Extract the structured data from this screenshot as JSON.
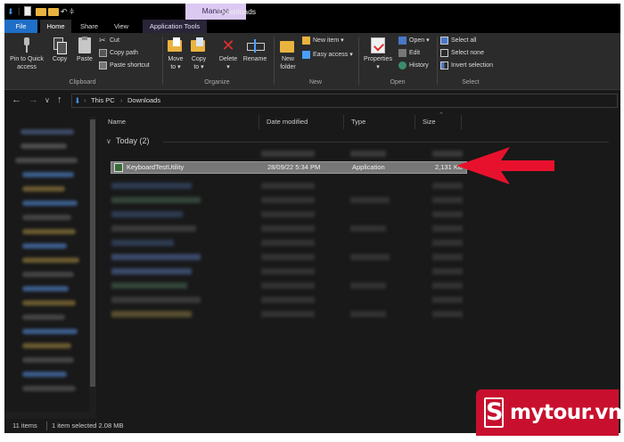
{
  "titlebar": {
    "context_tab": "Manage",
    "window_title": "Downloads"
  },
  "tabs": {
    "file": "File",
    "home": "Home",
    "share": "Share",
    "view": "View",
    "app_tools": "Application Tools"
  },
  "ribbon": {
    "clipboard": {
      "pin_line1": "Pin to Quick",
      "pin_line2": "access",
      "copy": "Copy",
      "paste": "Paste",
      "cut": "Cut",
      "copy_path": "Copy path",
      "paste_shortcut": "Paste shortcut",
      "label": "Clipboard"
    },
    "organize": {
      "move_line1": "Move",
      "move_line2": "to",
      "copy_line1": "Copy",
      "copy_line2": "to",
      "delete": "Delete",
      "rename": "Rename",
      "label": "Organize"
    },
    "new": {
      "new_folder_line1": "New",
      "new_folder_line2": "folder",
      "new_item": "New item",
      "easy_access": "Easy access",
      "label": "New"
    },
    "open": {
      "properties": "Properties",
      "open": "Open",
      "edit": "Edit",
      "history": "History",
      "label": "Open"
    },
    "select": {
      "select_all": "Select all",
      "select_none": "Select none",
      "invert_selection": "Invert selection",
      "label": "Select"
    }
  },
  "address": {
    "crumbs": [
      "This PC",
      "Downloads"
    ]
  },
  "columns": {
    "name": "Name",
    "date": "Date modified",
    "type": "Type",
    "size": "Size"
  },
  "group": {
    "label": "Today (2)"
  },
  "selected_file": {
    "name": "KeyboardTestUtility",
    "date": "28/09/22 5:34 PM",
    "type": "Application",
    "size": "2,131 KB"
  },
  "status": {
    "items": "11 items",
    "selection": "1 item selected  2.08 MB"
  },
  "logo": {
    "mark": "S",
    "text": "mytour.vn"
  },
  "colors": {
    "file_tab": "#1f6fc7",
    "manage_tab": "#dcc9f2",
    "arrow": "#e8112d",
    "logo_bg": "#c8102e"
  }
}
